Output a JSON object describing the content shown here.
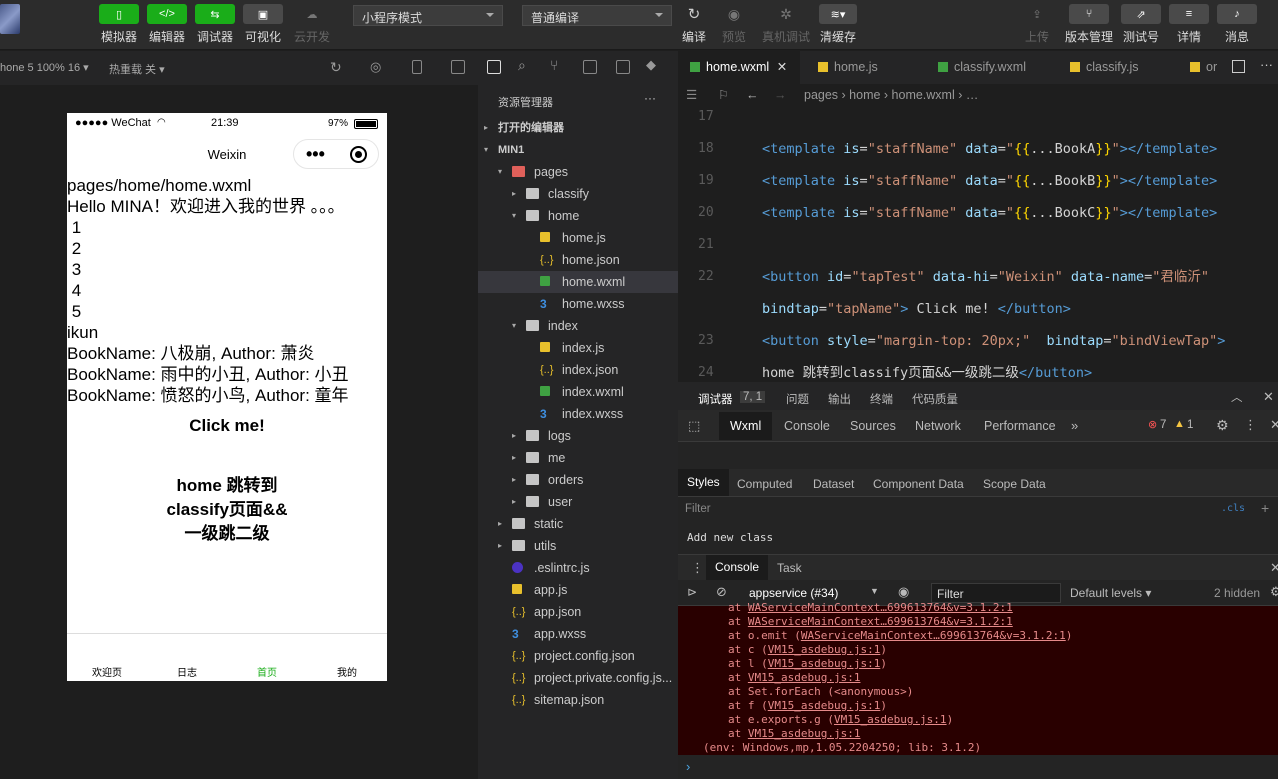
{
  "toolbar": {
    "buttons": [
      {
        "label": "模拟器",
        "glyph": "▯"
      },
      {
        "label": "编辑器",
        "glyph": "</>"
      },
      {
        "label": "调试器",
        "glyph": "⇆"
      },
      {
        "label": "可视化",
        "glyph": "▣"
      },
      {
        "label": "云开发",
        "glyph": "☁"
      }
    ],
    "mode_select": "小程序模式",
    "compile_select": "普通编译",
    "right_buttons": [
      {
        "label": "编译"
      },
      {
        "label": "预览"
      },
      {
        "label": "真机调试"
      },
      {
        "label": "清缓存"
      },
      {
        "label": "上传"
      },
      {
        "label": "版本管理"
      },
      {
        "label": "测试号"
      },
      {
        "label": "详情"
      },
      {
        "label": "消息"
      }
    ]
  },
  "subbar": {
    "device": "hone 5 100% 16 ▾",
    "hotreload": "热重载 关 ▾"
  },
  "phone": {
    "status": {
      "signal": "●●●●● WeChat",
      "time": "21:39",
      "battery": "97%"
    },
    "nav_title": "Weixin",
    "lines": [
      "pages/home/home.wxml",
      "Hello MINA！欢迎进入我的世界 。。。",
      " 1",
      " 2",
      " 3",
      " 4",
      " 5",
      "ikun",
      "BookName: 八极崩, Author: 萧炎",
      "BookName: 雨中的小丑, Author: 小丑",
      "BookName: 愤怒的小鸟, Author: 童年"
    ],
    "click_button": "Click me!",
    "jump_button_lines": [
      "home 跳转到",
      "classify页面&&",
      "一级跳二级"
    ],
    "tabs": [
      {
        "label": "欢迎页",
        "active": false
      },
      {
        "label": "日志",
        "active": false
      },
      {
        "label": "首页",
        "active": true
      },
      {
        "label": "我的",
        "active": false
      }
    ],
    "tab_active_color": "#1aad19"
  },
  "explorer": {
    "title": "资源管理器",
    "more": "···",
    "rows": [
      {
        "label": "打开的编辑器",
        "type": "section",
        "arrow": "▸",
        "indent": 0
      },
      {
        "label": "MIN1",
        "type": "section",
        "arrow": "▾",
        "indent": 0
      },
      {
        "label": "pages",
        "type": "folder-open-red",
        "arrow": "▾",
        "indent": 1
      },
      {
        "label": "classify",
        "type": "folder",
        "arrow": "▸",
        "indent": 2
      },
      {
        "label": "home",
        "type": "folder-open",
        "arrow": "▾",
        "indent": 2
      },
      {
        "label": "home.js",
        "type": "js",
        "arrow": "",
        "indent": 3
      },
      {
        "label": "home.json",
        "type": "json",
        "arrow": "",
        "indent": 3
      },
      {
        "label": "home.wxml",
        "type": "wxml",
        "arrow": "",
        "indent": 3,
        "selected": true
      },
      {
        "label": "home.wxss",
        "type": "wxss",
        "arrow": "",
        "indent": 3
      },
      {
        "label": "index",
        "type": "folder-open",
        "arrow": "▾",
        "indent": 2
      },
      {
        "label": "index.js",
        "type": "js",
        "arrow": "",
        "indent": 3
      },
      {
        "label": "index.json",
        "type": "json",
        "arrow": "",
        "indent": 3
      },
      {
        "label": "index.wxml",
        "type": "wxml",
        "arrow": "",
        "indent": 3
      },
      {
        "label": "index.wxss",
        "type": "wxss",
        "arrow": "",
        "indent": 3
      },
      {
        "label": "logs",
        "type": "folder",
        "arrow": "▸",
        "indent": 2
      },
      {
        "label": "me",
        "type": "folder",
        "arrow": "▸",
        "indent": 2
      },
      {
        "label": "orders",
        "type": "folder",
        "arrow": "▸",
        "indent": 2
      },
      {
        "label": "user",
        "type": "folder",
        "arrow": "▸",
        "indent": 2
      },
      {
        "label": "static",
        "type": "folder",
        "arrow": "▸",
        "indent": 1
      },
      {
        "label": "utils",
        "type": "folder",
        "arrow": "▸",
        "indent": 1
      },
      {
        "label": ".eslintrc.js",
        "type": "eslint",
        "arrow": "",
        "indent": 1
      },
      {
        "label": "app.js",
        "type": "js",
        "arrow": "",
        "indent": 1
      },
      {
        "label": "app.json",
        "type": "json",
        "arrow": "",
        "indent": 1
      },
      {
        "label": "app.wxss",
        "type": "wxss",
        "arrow": "",
        "indent": 1
      },
      {
        "label": "project.config.json",
        "type": "json",
        "arrow": "",
        "indent": 1
      },
      {
        "label": "project.private.config.js...",
        "type": "json",
        "arrow": "",
        "indent": 1
      },
      {
        "label": "sitemap.json",
        "type": "json",
        "arrow": "",
        "indent": 1
      }
    ]
  },
  "editor": {
    "tabs": [
      {
        "label": "home.wxml",
        "active": true,
        "type": "wxml",
        "close": "✕"
      },
      {
        "label": "home.js",
        "active": false,
        "type": "js"
      },
      {
        "label": "classify.wxml",
        "active": false,
        "type": "wxml"
      },
      {
        "label": "classify.js",
        "active": false,
        "type": "js"
      },
      {
        "label": "or",
        "active": false,
        "type": "js"
      }
    ],
    "breadcrumb": "pages › home › home.wxml › …",
    "lines": [
      {
        "n": "17",
        "tokens": []
      },
      {
        "n": "18",
        "tokens": [
          [
            "tg",
            "<template "
          ],
          [
            "at",
            "is"
          ],
          [
            "pl",
            "="
          ],
          [
            "sv",
            "\"staffName\""
          ],
          [
            "at",
            " data"
          ],
          [
            "pl",
            "="
          ],
          [
            "sv",
            "\""
          ],
          [
            "br",
            "{{"
          ],
          [
            "pl",
            "...BookA"
          ],
          [
            "br",
            "}}"
          ],
          [
            "sv",
            "\""
          ],
          [
            "tg",
            "></template>"
          ]
        ]
      },
      {
        "n": "19",
        "tokens": [
          [
            "tg",
            "<template "
          ],
          [
            "at",
            "is"
          ],
          [
            "pl",
            "="
          ],
          [
            "sv",
            "\"staffName\""
          ],
          [
            "at",
            " data"
          ],
          [
            "pl",
            "="
          ],
          [
            "sv",
            "\""
          ],
          [
            "br",
            "{{"
          ],
          [
            "pl",
            "...BookB"
          ],
          [
            "br",
            "}}"
          ],
          [
            "sv",
            "\""
          ],
          [
            "tg",
            "></template>"
          ]
        ]
      },
      {
        "n": "20",
        "tokens": [
          [
            "tg",
            "<template "
          ],
          [
            "at",
            "is"
          ],
          [
            "pl",
            "="
          ],
          [
            "sv",
            "\"staffName\""
          ],
          [
            "at",
            " data"
          ],
          [
            "pl",
            "="
          ],
          [
            "sv",
            "\""
          ],
          [
            "br",
            "{{"
          ],
          [
            "pl",
            "...BookC"
          ],
          [
            "br",
            "}}"
          ],
          [
            "sv",
            "\""
          ],
          [
            "tg",
            "></template>"
          ]
        ]
      },
      {
        "n": "21",
        "tokens": []
      },
      {
        "n": "22",
        "tokens": [
          [
            "tg",
            "<button "
          ],
          [
            "at",
            "id"
          ],
          [
            "pl",
            "="
          ],
          [
            "sv",
            "\"tapTest\""
          ],
          [
            "at",
            " data-hi"
          ],
          [
            "pl",
            "="
          ],
          [
            "sv",
            "\"Weixin\""
          ],
          [
            "at",
            " data-name"
          ],
          [
            "pl",
            "="
          ],
          [
            "sv",
            "\"君临沂\""
          ]
        ]
      },
      {
        "n": "",
        "tokens": [
          [
            "at",
            "bindtap"
          ],
          [
            "pl",
            "="
          ],
          [
            "sv",
            "\"tapName\""
          ],
          [
            "tg",
            ">"
          ],
          [
            "pl",
            " Click me! "
          ],
          [
            "tg",
            "</button>"
          ]
        ]
      },
      {
        "n": "23",
        "tokens": [
          [
            "tg",
            "<button "
          ],
          [
            "at",
            "style"
          ],
          [
            "pl",
            "="
          ],
          [
            "sv",
            "\"margin-top: 20px;\""
          ],
          [
            "at",
            "  bindtap"
          ],
          [
            "pl",
            "="
          ],
          [
            "sv",
            "\"bindViewTap\""
          ],
          [
            "tg",
            ">"
          ]
        ]
      },
      {
        "n": "24",
        "tokens": [
          [
            "pl",
            "home 跳转到classify页面&&一级跳二级"
          ],
          [
            "tg",
            "</button>"
          ]
        ]
      }
    ]
  },
  "devtools": {
    "top_tabs": [
      "调试器",
      "7, 1",
      "问题",
      "输出",
      "终端",
      "代码质量"
    ],
    "panel_tabs": [
      "Wxml",
      "Console",
      "Sources",
      "Network",
      "Performance",
      "»"
    ],
    "errors": "7",
    "warnings": "1",
    "style_tabs": [
      "Styles",
      "Computed",
      "Dataset",
      "Component Data",
      "Scope Data"
    ],
    "filter_placeholder": "Filter",
    "cls": ".cls",
    "add_class": "Add new class",
    "console_tabs": [
      "Console",
      "Task"
    ],
    "context": "appservice (#34)",
    "console_filter": "Filter",
    "levels": "Default levels ▾",
    "hidden": "2 hidden",
    "log_lines": [
      [
        "at ",
        "WAServiceMainContext…699613764&v=3.1.2:1",
        ""
      ],
      [
        "at ",
        "WAServiceMainContext…699613764&v=3.1.2:1",
        ""
      ],
      [
        "at o.emit (",
        "WAServiceMainContext…699613764&v=3.1.2:1",
        ")"
      ],
      [
        "at c (",
        "VM15_asdebug.js:1",
        ")"
      ],
      [
        "at l (",
        "VM15_asdebug.js:1",
        ")"
      ],
      [
        "at ",
        "VM15_asdebug.js:1",
        ""
      ],
      [
        "at Set.forEach (<anonymous>)",
        "",
        ""
      ],
      [
        "at f (",
        "VM15_asdebug.js:1",
        ")"
      ],
      [
        "at e.exports.g (",
        "VM15_asdebug.js:1",
        ")"
      ],
      [
        "at ",
        "VM15_asdebug.js:1",
        ""
      ]
    ],
    "env_line": "(env: Windows,mp,1.05.2204250; lib: 3.1.2)",
    "prompt": "›"
  }
}
